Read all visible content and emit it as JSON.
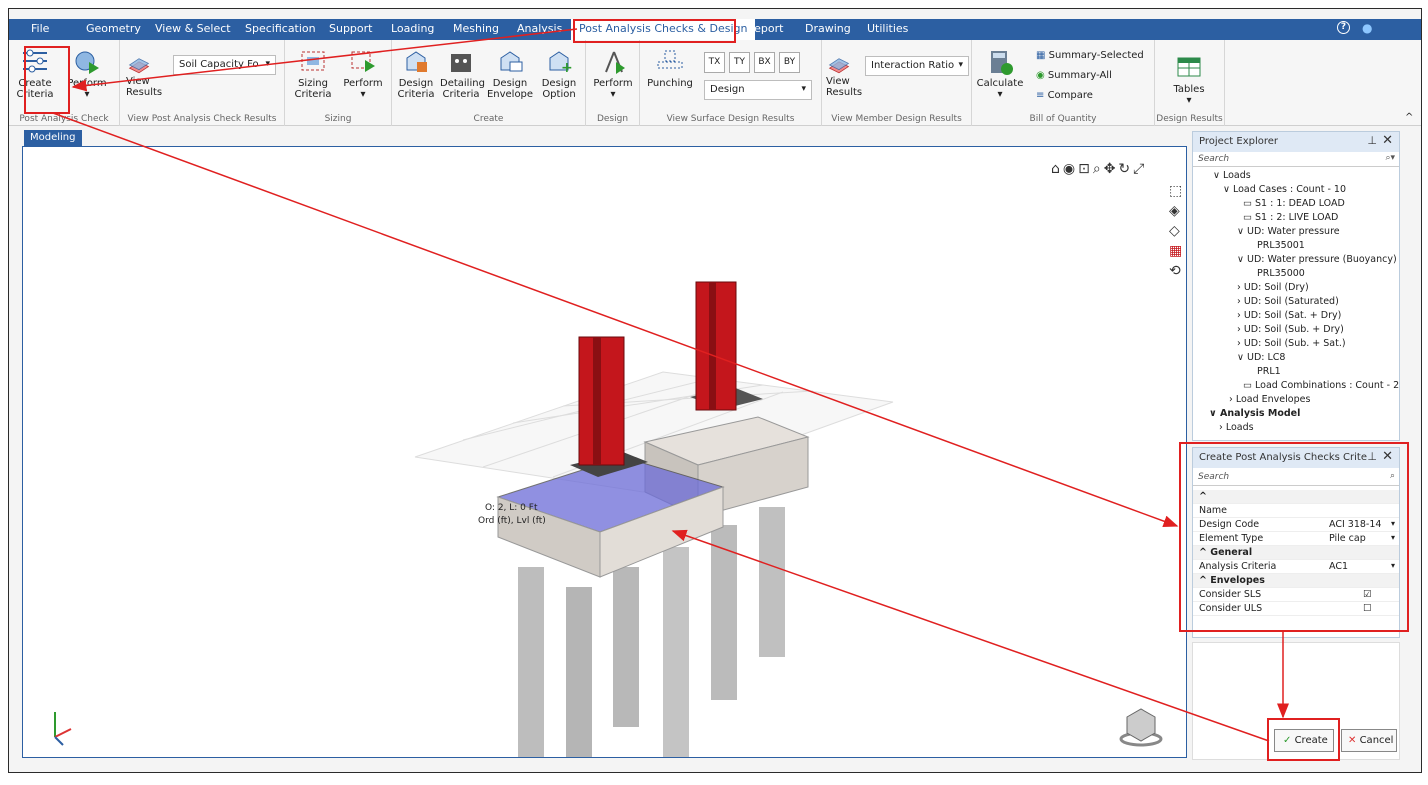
{
  "menu": {
    "file": "File",
    "geometry": "Geometry",
    "view_select": "View & Select",
    "specification": "Specification",
    "support": "Support",
    "loading": "Loading",
    "meshing": "Meshing",
    "analysis": "Analysis",
    "post_analysis": "Post Analysis Checks & Design",
    "report": "Report",
    "drawing": "Drawing",
    "utilities": "Utilities"
  },
  "ribbon": {
    "create_criteria": "Create Criteria",
    "perform": "Perform",
    "view_results": "View Results",
    "soil_capacity": "Soil Capacity Fo",
    "grp_post": "Post Analysis Check",
    "grp_view_post": "View Post Analysis Check Results",
    "sizing_criteria": "Sizing Criteria",
    "perform2": "Perform",
    "grp_sizing": "Sizing",
    "design_criteria": "Design Criteria",
    "detailing_criteria": "Detailing Criteria",
    "design_envelope": "Design Envelope",
    "design_option": "Design Option",
    "grp_create": "Create",
    "perform3": "Perform",
    "grp_design": "Design",
    "punching": "Punching",
    "tx": "TX",
    "ty": "TY",
    "bx": "BX",
    "by": "BY",
    "design_select": "Design",
    "grp_surface": "View Surface Design Results",
    "view_results2": "View Results",
    "interaction_ratio": "Interaction Ratio",
    "grp_member": "View Member Design Results",
    "calculate": "Calculate",
    "summary_selected": "Summary-Selected",
    "summary_all": "Summary-All",
    "compare": "Compare",
    "grp_boq": "Bill of Quantity",
    "tables": "Tables",
    "grp_design_results": "Design Results"
  },
  "modeling_tab": "Modeling",
  "viewport": {
    "label_line1": "O: 2, L: 0 Ft",
    "label_line2": "Ord (ft), Lvl (ft)"
  },
  "project_explorer": {
    "title": "Project Explorer",
    "search": "Search",
    "tree": [
      "Loads",
      "Load Cases : Count - 10",
      "S1 : 1: DEAD LOAD",
      "S1 : 2: LIVE LOAD",
      "UD: Water pressure",
      "PRL35001",
      "UD: Water pressure (Buoyancy)",
      "PRL35000",
      "UD: Soil (Dry)",
      "UD: Soil (Saturated)",
      "UD: Soil (Sat. + Dry)",
      "UD: Soil (Sub. + Dry)",
      "UD: Soil (Sub. + Sat.)",
      "UD: LC8",
      "PRL1",
      "Load Combinations : Count - 2",
      "Load Envelopes",
      "Analysis Model",
      "Loads"
    ]
  },
  "criteria_panel": {
    "title": "Create Post Analysis Checks Crite",
    "search": "Search",
    "name": "Name",
    "design_code": "Design Code",
    "design_code_val": "ACI 318-14",
    "element_type": "Element Type",
    "element_type_val": "Pile cap",
    "general": "General",
    "analysis_criteria": "Analysis Criteria",
    "analysis_criteria_val": "AC1",
    "envelopes": "Envelopes",
    "consider_sls": "Consider SLS",
    "consider_uls": "Consider ULS",
    "sls_checked": true,
    "uls_checked": false
  },
  "buttons": {
    "create": "Create",
    "cancel": "Cancel"
  },
  "colors": {
    "accent": "#2c5fa2",
    "highlight": "#e02020",
    "column": "#c4161c"
  }
}
